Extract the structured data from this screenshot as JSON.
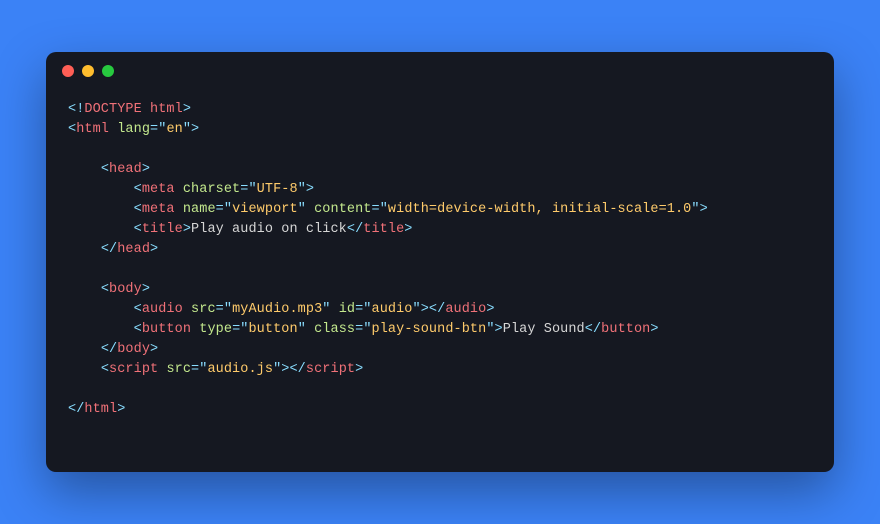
{
  "code": {
    "l1": {
      "open": "<!",
      "doctype": "DOCTYPE html",
      "close": ">"
    },
    "l2": {
      "open": "<",
      "tag": "html",
      "sp": " ",
      "attr": "lang",
      "eq": "=",
      "q1": "\"",
      "val": "en",
      "q2": "\"",
      "close": ">"
    },
    "l3": {
      "indent": "    ",
      "open": "<",
      "tag": "head",
      "close": ">"
    },
    "l4": {
      "indent": "        ",
      "open": "<",
      "tag": "meta",
      "sp": " ",
      "attr": "charset",
      "eq": "=",
      "q1": "\"",
      "val": "UTF-8",
      "q2": "\"",
      "close": ">"
    },
    "l5": {
      "indent": "        ",
      "open": "<",
      "tag": "meta",
      "sp1": " ",
      "attr1": "name",
      "eq1": "=",
      "q1a": "\"",
      "val1": "viewport",
      "q1b": "\"",
      "sp2": " ",
      "attr2": "content",
      "eq2": "=",
      "q2a": "\"",
      "val2": "width=device-width, initial-scale=1.0",
      "q2b": "\"",
      "close": ">"
    },
    "l6": {
      "indent": "        ",
      "open": "<",
      "tag": "title",
      "close1": ">",
      "text": "Play audio on click",
      "open2": "</",
      "tag2": "title",
      "close2": ">"
    },
    "l7": {
      "indent": "    ",
      "open": "</",
      "tag": "head",
      "close": ">"
    },
    "l8": {
      "indent": "    ",
      "open": "<",
      "tag": "body",
      "close": ">"
    },
    "l9": {
      "indent": "        ",
      "open": "<",
      "tag": "audio",
      "sp1": " ",
      "attr1": "src",
      "eq1": "=",
      "q1a": "\"",
      "val1": "myAudio.mp3",
      "q1b": "\"",
      "sp2": " ",
      "attr2": "id",
      "eq2": "=",
      "q2a": "\"",
      "val2": "audio",
      "q2b": "\"",
      "close1": ">",
      "open2": "</",
      "tag2": "audio",
      "close2": ">"
    },
    "l10": {
      "indent": "        ",
      "open": "<",
      "tag": "button",
      "sp1": " ",
      "attr1": "type",
      "eq1": "=",
      "q1a": "\"",
      "val1": "button",
      "q1b": "\"",
      "sp2": " ",
      "attr2": "class",
      "eq2": "=",
      "q2a": "\"",
      "val2": "play-sound-btn",
      "q2b": "\"",
      "close1": ">",
      "text": "Play Sound",
      "open2": "</",
      "tag2": "button",
      "close2": ">"
    },
    "l11": {
      "indent": "    ",
      "open": "</",
      "tag": "body",
      "close": ">"
    },
    "l12": {
      "indent": "    ",
      "open": "<",
      "tag": "script",
      "sp": " ",
      "attr": "src",
      "eq": "=",
      "q1": "\"",
      "val": "audio.js",
      "q2": "\"",
      "close1": ">",
      "open2": "</",
      "tag2": "script",
      "close2": ">"
    },
    "l13": {
      "open": "</",
      "tag": "html",
      "close": ">"
    }
  }
}
